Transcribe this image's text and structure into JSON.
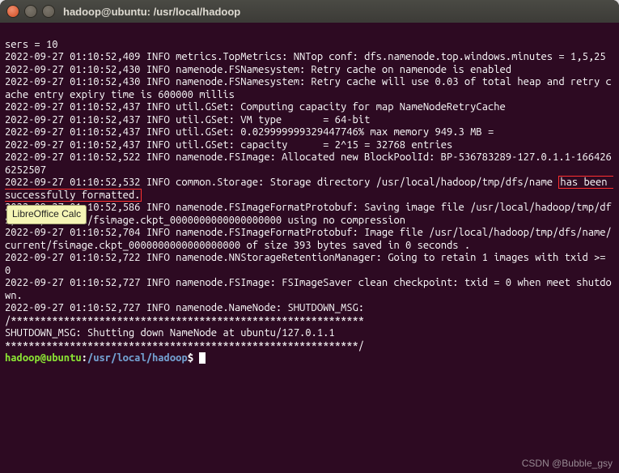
{
  "window": {
    "title": "hadoop@ubuntu: /usr/local/hadoop"
  },
  "tooltip": {
    "text": "LibreOffice Calc"
  },
  "watermark": {
    "text": "CSDN @Bubble_gsy"
  },
  "log": {
    "l00": "sers = 10",
    "l01": "2022-09-27 01:10:52,409 INFO metrics.TopMetrics: NNTop conf: dfs.namenode.top.windows.minutes = 1,5,25",
    "l02": "2022-09-27 01:10:52,430 INFO namenode.FSNamesystem: Retry cache on namenode is enabled",
    "l03": "2022-09-27 01:10:52,430 INFO namenode.FSNamesystem: Retry cache will use 0.03 of total heap and retry cache entry expiry time is 600000 millis",
    "l04": "2022-09-27 01:10:52,437 INFO util.GSet: Computing capacity for map NameNodeRetryCache",
    "l05": "2022-09-27 01:10:52,437 INFO util.GSet: VM type       = 64-bit",
    "l06": "2022-09-27 01:10:52,437 INFO util.GSet: 0.029999999329447746% max memory 949.3 MB = ",
    "l07": "2022-09-27 01:10:52,437 INFO util.GSet: capacity      = 2^15 = 32768 entries",
    "l08": "2022-09-27 01:10:52,522 INFO namenode.FSImage: Allocated new BlockPoolId: BP-536783289-127.0.1.1-1664266252507",
    "l09a": "2022-09-27 01:10:52,532 INFO common.Storage: Storage directory /usr/local/hadoop/tmp/dfs/name ",
    "l09b": "has been successfully formatted.",
    "l10": "2022-09-27 01:10:52,586 INFO namenode.FSImageFormatProtobuf: Saving image file /usr/local/hadoop/tmp/dfs/name/current/fsimage.ckpt_0000000000000000000 using no compression",
    "l11": "2022-09-27 01:10:52,704 INFO namenode.FSImageFormatProtobuf: Image file /usr/local/hadoop/tmp/dfs/name/current/fsimage.ckpt_0000000000000000000 of size 393 bytes saved in 0 seconds .",
    "l12": "2022-09-27 01:10:52,722 INFO namenode.NNStorageRetentionManager: Going to retain 1 images with txid >= 0",
    "l13": "2022-09-27 01:10:52,727 INFO namenode.FSImage: FSImageSaver clean checkpoint: txid = 0 when meet shutdown.",
    "l14": "2022-09-27 01:10:52,727 INFO namenode.NameNode: SHUTDOWN_MSG:",
    "l15": "/************************************************************",
    "l16": "SHUTDOWN_MSG: Shutting down NameNode at ubuntu/127.0.1.1",
    "l17": "************************************************************/"
  },
  "prompt": {
    "user": "hadoop@ubuntu",
    "sep": ":",
    "path": "/usr/local/hadoop",
    "end": "$"
  }
}
